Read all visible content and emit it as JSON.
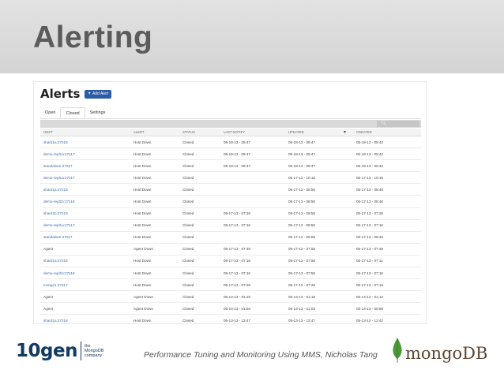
{
  "slide": {
    "title": "Alerting",
    "caption": "Performance Tuning and Monitoring Using MMS, Nicholas Tang",
    "logo_left": {
      "word": "10gen",
      "sub_lines": [
        "the",
        "MongoDB",
        "company"
      ]
    },
    "logo_right": {
      "word": "mongoDB"
    }
  },
  "app": {
    "page_title": "Alerts",
    "add_button_label": "Add Alert",
    "tabs": [
      {
        "label": "Open"
      },
      {
        "label": "Closed"
      },
      {
        "label": "Settings"
      }
    ],
    "active_tab": "Closed",
    "columns": {
      "host": "Host",
      "alert": "Alert",
      "status": "Status",
      "last_notify": "Last Notify",
      "updated": "Updated",
      "created": "Created"
    },
    "rows": [
      {
        "host": "shard1a:27218",
        "alert": "Host Down",
        "status": "Closed",
        "last_notify": "05-18-13 - 09:47",
        "updated": "05-18-13 - 09:47",
        "created": "05-18-13 - 09:42"
      },
      {
        "host": "demo-repl1a:27117",
        "alert": "Host Down",
        "status": "Closed",
        "last_notify": "05-18-13 - 09:47",
        "updated": "05-18-13 - 09:47",
        "created": "05-18-13 - 09:42"
      },
      {
        "host": "standalone:27017",
        "alert": "Host Down",
        "status": "Closed",
        "last_notify": "05-18-13 - 09:47",
        "updated": "05-18-13 - 09:47",
        "created": "05-18-13 - 09:42"
      },
      {
        "host": "demo-repl1a:27117",
        "alert": "Host Down",
        "status": "Closed",
        "last_notify": "",
        "updated": "05-17-13 - 10:16",
        "created": "05-17-13 - 10:15"
      },
      {
        "host": "shard1a:27218",
        "alert": "Host Down",
        "status": "Closed",
        "last_notify": "",
        "updated": "05-17-13 - 08:56",
        "created": "05-17-13 - 08:46"
      },
      {
        "host": "demo-repl1b:27118",
        "alert": "Host Down",
        "status": "Closed",
        "last_notify": "",
        "updated": "05-17-13 - 08:56",
        "created": "05-17-13 - 08:46"
      },
      {
        "host": "shard1b:27219",
        "alert": "Host Down",
        "status": "Closed",
        "last_notify": "05-17-13 - 07:26",
        "updated": "05-17-13 - 08:56",
        "created": "05-17-13 - 07:26"
      },
      {
        "host": "demo-repl1a:27117",
        "alert": "Host Down",
        "status": "Closed",
        "last_notify": "05-17-13 - 07:16",
        "updated": "05-17-13 - 08:56",
        "created": "05-17-13 - 07:16"
      },
      {
        "host": "standalone:27017",
        "alert": "Host Down",
        "status": "Closed",
        "last_notify": "",
        "updated": "05-17-13 - 08:56",
        "created": "05-17-13 - 08:46"
      },
      {
        "host": "Agent",
        "alert": "Agent Down",
        "status": "Closed",
        "last_notify": "05-17-13 - 07:46",
        "updated": "05-17-13 - 07:56",
        "created": "05-17-13 - 07:46"
      },
      {
        "host": "shard1a:27218",
        "alert": "Host Down",
        "status": "Closed",
        "last_notify": "05-17-13 - 07:16",
        "updated": "05-17-13 - 07:56",
        "created": "05-17-13 - 07:11"
      },
      {
        "host": "demo-repl1b:27118",
        "alert": "Host Down",
        "status": "Closed",
        "last_notify": "05-17-13 - 07:16",
        "updated": "05-17-13 - 07:56",
        "created": "05-17-13 - 07:16"
      },
      {
        "host": "mongo1:27317",
        "alert": "Host Down",
        "status": "Closed",
        "last_notify": "05-17-13 - 07:26",
        "updated": "05-17-13 - 07:26",
        "created": "05-17-13 - 07:16"
      },
      {
        "host": "Agent",
        "alert": "Agent Down",
        "status": "Closed",
        "last_notify": "05-14-13 - 01:18",
        "updated": "05-14-13 - 01:18",
        "created": "05-14-13 - 01:13"
      },
      {
        "host": "Agent",
        "alert": "Agent Down",
        "status": "Closed",
        "last_notify": "05-14-13 - 01:03",
        "updated": "05-14-13 - 01:03",
        "created": "05-14-13 - 00:58"
      },
      {
        "host": "shard1a:27218",
        "alert": "Host Down",
        "status": "Closed",
        "last_notify": "05-13-13 - 13:47",
        "updated": "05-13-13 - 13:47",
        "created": "05-13-13 - 13:42"
      }
    ]
  },
  "icons": {
    "add": "plus-icon",
    "search": "search-icon",
    "sort": "sort-desc-icon",
    "leaf": "mongodb-leaf-icon"
  },
  "colors": {
    "accent": "#2a5ba7",
    "link": "#3a6aa8",
    "title": "#5b5b5b"
  }
}
